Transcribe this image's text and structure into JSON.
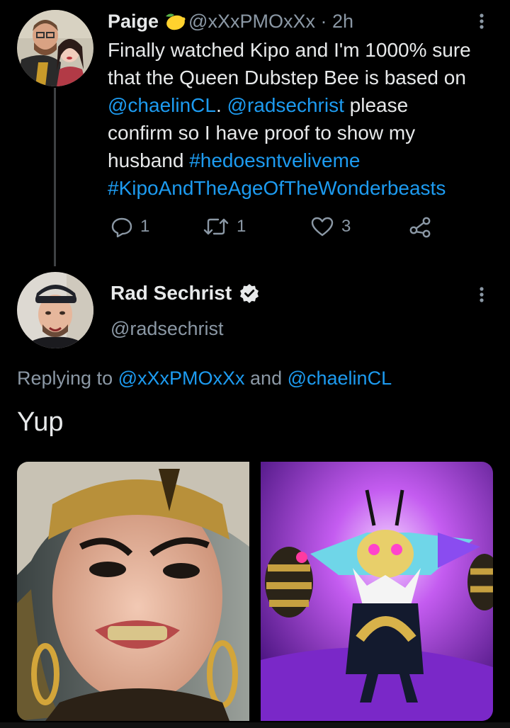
{
  "tweet1": {
    "name": "Paige",
    "handle": "@xXxPMOxXx",
    "separator": "·",
    "time": "2h",
    "emoji_icon": "lemon-emoji",
    "text_lines": [
      "Finally watched Kipo and I'm 1000% sure",
      "that the Queen Dubstep Bee is based on"
    ],
    "mention1": "@chaelinCL",
    "after_mention1": ". ",
    "mention2": "@radsechrist",
    "after_mention2": " please",
    "line4": "confirm so I have proof to show my",
    "line5_text": "husband ",
    "hashtag1": "#hedoesntveliveme",
    "hashtag2": "#KipoAndTheAgeOfTheWonderbeasts",
    "actions": {
      "reply_count": "1",
      "retweet_count": "1",
      "like_count": "3"
    }
  },
  "tweet2": {
    "name": "Rad Sechrist",
    "verified": true,
    "handle": "@radsechrist",
    "replying_prefix": "Replying to ",
    "replying_user1": "@xXxPMOxXx",
    "replying_and": " and ",
    "replying_user2": "@chaelinCL",
    "text": "Yup"
  },
  "colors": {
    "background": "#000000",
    "text": "#e7e9ea",
    "muted": "#8b98a5",
    "link": "#1d9bf0",
    "thread_line": "#3e4144"
  }
}
